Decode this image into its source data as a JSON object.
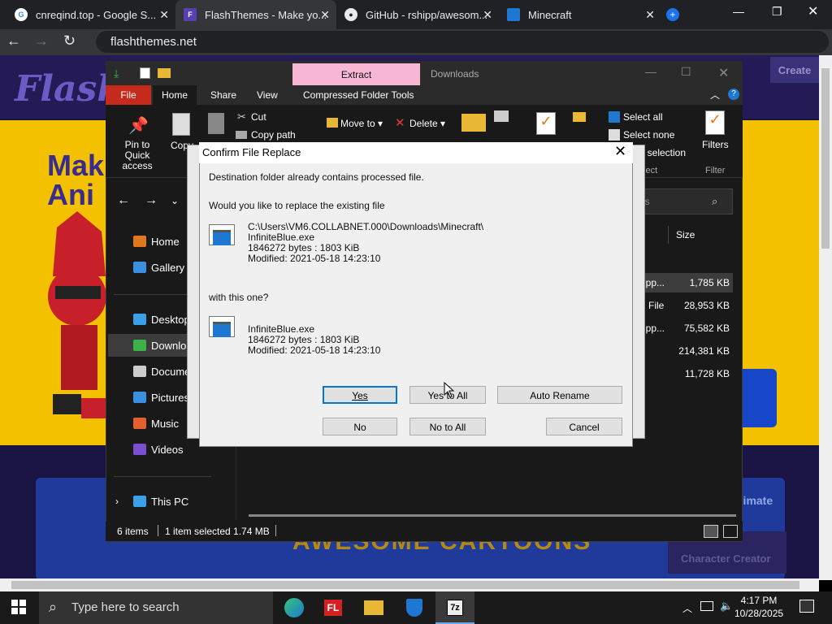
{
  "browser": {
    "tabs": [
      {
        "title": "cnreqind.top - Google S..."
      },
      {
        "title": "FlashThemes - Make yo..."
      },
      {
        "title": "GitHub - rshipp/awesom..."
      },
      {
        "title": "Minecraft"
      }
    ],
    "url": "flashthemes.net"
  },
  "website": {
    "create_label": "Create",
    "headline_1": "Mak",
    "headline_2": "Ani",
    "awesome_text": "AWESOME CARTOONS",
    "character_creator": "Character Creator",
    "animate": "nimate"
  },
  "explorer": {
    "tab_extract": "Extract",
    "tab_downloads": "Downloads",
    "ribbon_tabs": {
      "file": "File",
      "home": "Home",
      "share": "Share",
      "view": "View",
      "compressed": "Compressed Folder Tools"
    },
    "ribbon": {
      "pin": "Pin to Quick access",
      "copy": "Copy",
      "cut": "Cut",
      "copy_path": "Copy path",
      "move_to": "Move to",
      "delete": "Delete",
      "select_all": "Select all",
      "select_none": "Select none",
      "invert": "t selection",
      "select_group": "elect",
      "filters": "Filters",
      "filter_group": "Filter"
    },
    "search_placeholder": "ds",
    "column_size": "Size",
    "nav": [
      "Home",
      "Gallery",
      "Desktop",
      "Downloa",
      "Docume",
      "Pictures",
      "Music",
      "Videos",
      "This PC"
    ],
    "files": [
      {
        "name": "ipp...",
        "size": "1,785 KB"
      },
      {
        "name": "File",
        "size": "28,953 KB"
      },
      {
        "name": "ipp...",
        "size": "75,582 KB"
      },
      {
        "name": "",
        "size": "214,381 KB"
      },
      {
        "name": "",
        "size": "11,728 KB"
      }
    ],
    "status": {
      "items": "6 items",
      "selected": "1 item selected  1.74 MB"
    }
  },
  "dialog": {
    "title": "Confirm File Replace",
    "line1": "Destination folder already contains processed file.",
    "line2": "Would you like to replace the existing file",
    "existing": {
      "path": "C:\\Users\\VM6.COLLABNET.000\\Downloads\\Minecraft\\",
      "name": "InfiniteBlue.exe",
      "size": "1846272 bytes : 1803 KiB",
      "modified": "Modified: 2021-05-18 14:23:10"
    },
    "with_this": "with this one?",
    "incoming": {
      "name": "InfiniteBlue.exe",
      "size": "1846272 bytes : 1803 KiB",
      "modified": "Modified: 2021-05-18 14:23:10"
    },
    "buttons": {
      "yes": "Yes",
      "yes_all": "Yes to All",
      "auto_rename": "Auto Rename",
      "no": "No",
      "no_all": "No to All",
      "cancel": "Cancel"
    }
  },
  "taskbar": {
    "search_placeholder": "Type here to search",
    "time": "4:17 PM",
    "date": "10/28/2025",
    "apps": [
      "edge-icon",
      "fl-studio-icon",
      "file-explorer-icon",
      "defender-icon",
      "7zip-icon"
    ]
  }
}
